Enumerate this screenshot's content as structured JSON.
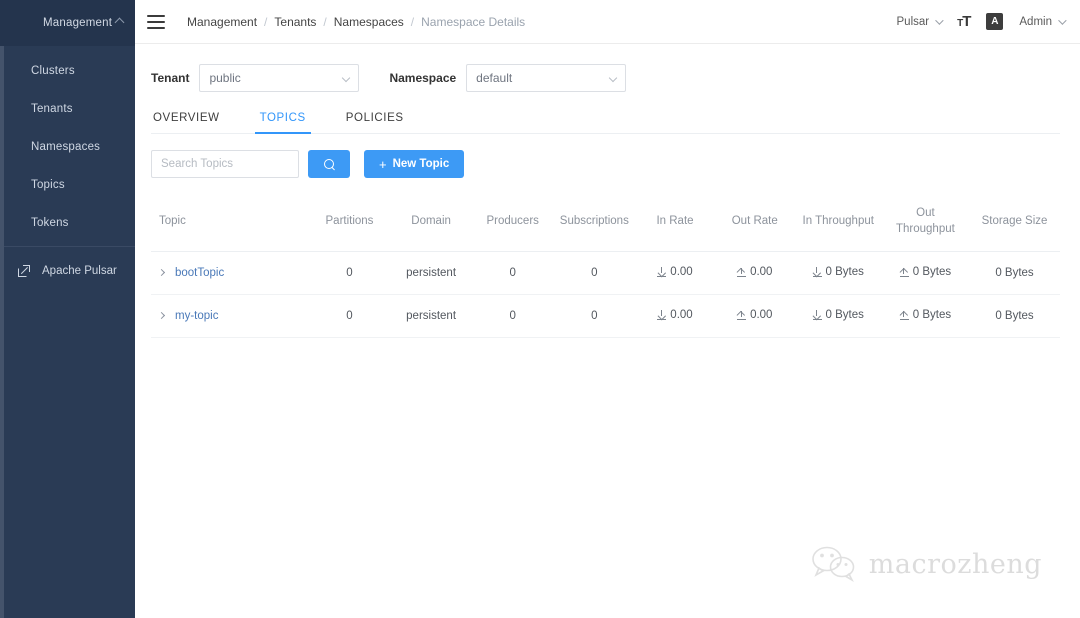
{
  "sidebar": {
    "header": {
      "label": "Management",
      "icon": "grid-icon",
      "chevron": "chevron-up-icon"
    },
    "items": [
      {
        "label": "Clusters"
      },
      {
        "label": "Tenants"
      },
      {
        "label": "Namespaces"
      },
      {
        "label": "Topics"
      },
      {
        "label": "Tokens"
      }
    ],
    "external": {
      "label": "Apache Pulsar",
      "icon": "external-link-icon"
    },
    "colors": {
      "background": "#2a3b55",
      "header_background": "#24344d",
      "text": "#cfd7e3"
    }
  },
  "topbar": {
    "menu_icon": "hamburger-icon",
    "breadcrumb": [
      {
        "label": "Management",
        "current": false
      },
      {
        "label": "Tenants",
        "current": false
      },
      {
        "label": "Namespaces",
        "current": false
      },
      {
        "label": "Namespace Details",
        "current": true
      }
    ],
    "separator": "/",
    "right": {
      "cluster_label": "Pulsar",
      "font_size_icon": "font-size-icon",
      "font_size_glyph_small": "T",
      "font_size_glyph_large": "T",
      "language_icon": "translate-icon",
      "language_glyph": "A",
      "user_label": "Admin"
    }
  },
  "selectors": {
    "tenant": {
      "label": "Tenant",
      "value": "public"
    },
    "namespace": {
      "label": "Namespace",
      "value": "default"
    }
  },
  "tabs": [
    {
      "label": "OVERVIEW",
      "active": false
    },
    {
      "label": "TOPICS",
      "active": true
    },
    {
      "label": "POLICIES",
      "active": false
    }
  ],
  "toolbar": {
    "search_placeholder": "Search Topics",
    "search_value": "",
    "search_button_icon": "search-icon",
    "new_topic_label": "New Topic",
    "new_topic_plus": "+",
    "accent_color": "#3d9af5"
  },
  "table": {
    "columns": [
      "Topic",
      "Partitions",
      "Domain",
      "Producers",
      "Subscriptions",
      "In Rate",
      "Out Rate",
      "In Throughput",
      "Out Throughput",
      "Storage Size"
    ],
    "rows": [
      {
        "topic": "bootTopic",
        "partitions": "0",
        "domain": "persistent",
        "producers": "0",
        "subscriptions": "0",
        "in_rate": "0.00",
        "out_rate": "0.00",
        "in_throughput": "0 Bytes",
        "out_throughput": "0 Bytes",
        "storage_size": "0 Bytes"
      },
      {
        "topic": "my-topic",
        "partitions": "0",
        "domain": "persistent",
        "producers": "0",
        "subscriptions": "0",
        "in_rate": "0.00",
        "out_rate": "0.00",
        "in_throughput": "0 Bytes",
        "out_throughput": "0 Bytes",
        "storage_size": "0 Bytes"
      }
    ]
  },
  "watermark": {
    "text": "macrozheng",
    "icon": "wechat-icon"
  }
}
